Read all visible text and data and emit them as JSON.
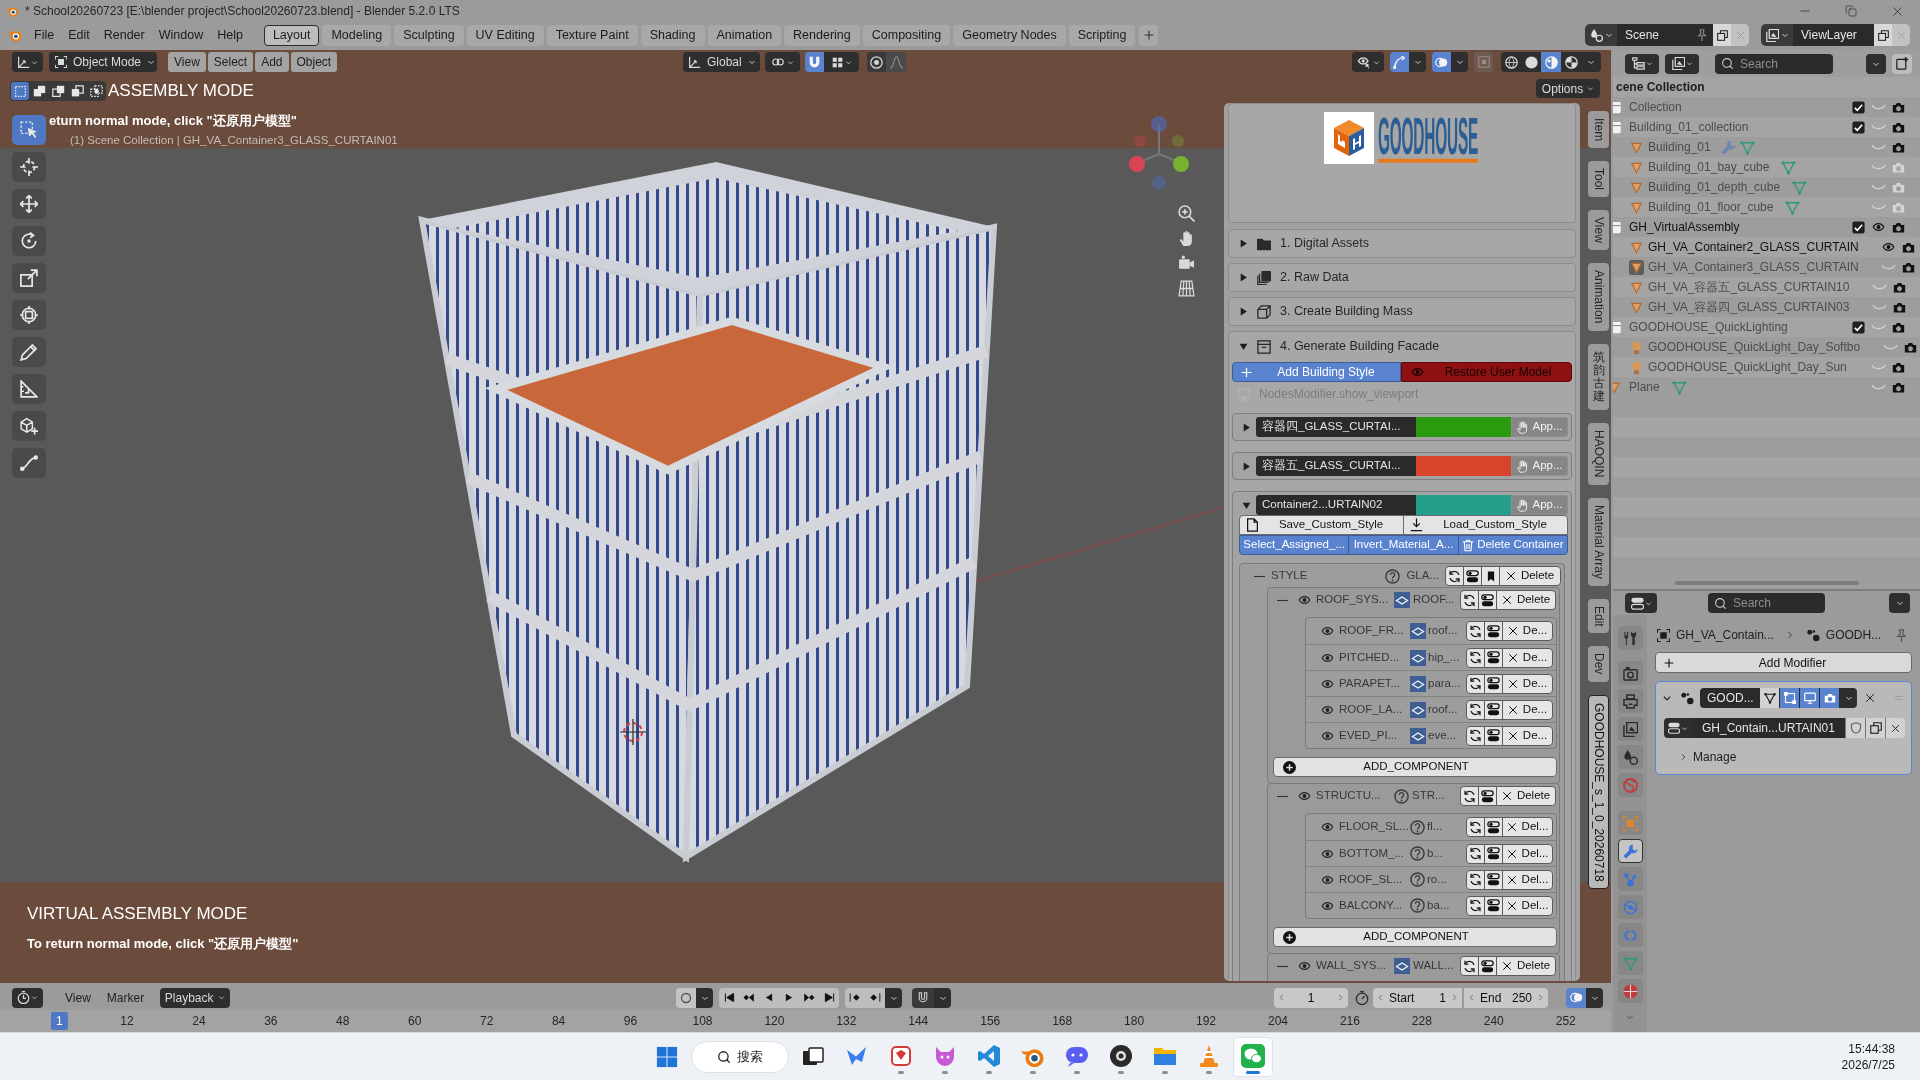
{
  "window": {
    "title": "* School20260723 [E:\\blender project\\School20260723.blend] - Blender 5.2.0 LTS"
  },
  "menu": [
    "File",
    "Edit",
    "Render",
    "Window",
    "Help"
  ],
  "workspaces": [
    {
      "label": "Layout",
      "selected": true
    },
    {
      "label": "Modeling",
      "selected": false
    },
    {
      "label": "Sculpting",
      "selected": false
    },
    {
      "label": "UV Editing",
      "selected": false
    },
    {
      "label": "Texture Paint",
      "selected": false
    },
    {
      "label": "Shading",
      "selected": false
    },
    {
      "label": "Animation",
      "selected": false
    },
    {
      "label": "Rendering",
      "selected": false
    },
    {
      "label": "Compositing",
      "selected": false
    },
    {
      "label": "Geometry Nodes",
      "selected": false
    },
    {
      "label": "Scripting",
      "selected": false
    }
  ],
  "scene": {
    "name": "Scene"
  },
  "view_layer": {
    "name": "ViewLayer"
  },
  "viewport": {
    "mode": "Object Mode",
    "menus": [
      "View",
      "Select",
      "Add",
      "Object"
    ],
    "orientation": "Global",
    "snap": true,
    "proportional": false,
    "gizmos": true,
    "overlays": true,
    "xray": false,
    "shading": [
      {
        "kind": "wireframe",
        "selected": false
      },
      {
        "kind": "solid",
        "selected": false
      },
      {
        "kind": "material",
        "selected": true
      },
      {
        "kind": "rendered",
        "selected": false
      }
    ],
    "options": "Options",
    "select_modes": [
      {
        "kind": "set",
        "selected": true
      },
      {
        "kind": "extend",
        "selected": false
      },
      {
        "kind": "subtract",
        "selected": false
      },
      {
        "kind": "difference",
        "selected": false
      },
      {
        "kind": "intersect",
        "selected": false
      }
    ],
    "title": "ASSEMBLY MODE",
    "hint": "eturn normal mode, click \"还原用户模型\"",
    "context": "(1) Scene Collection | GH_VA_Container3_GLASS_CURTAIN01",
    "tools": [
      {
        "kind": "select_box",
        "selected": true
      },
      {
        "kind": "cursor",
        "selected": false
      },
      {
        "kind": "move",
        "selected": false
      },
      {
        "kind": "rotate",
        "selected": false
      },
      {
        "kind": "scale",
        "selected": false
      },
      {
        "kind": "transform",
        "selected": false
      },
      {
        "kind": "annotate",
        "selected": false
      },
      {
        "kind": "measure",
        "selected": false
      },
      {
        "kind": "add_cube",
        "selected": false
      },
      {
        "kind": "shear",
        "selected": false
      }
    ],
    "footer_title": "VIRTUAL ASSEMBLY MODE",
    "footer_hint": "To return normal mode, click \"还原用户模型\""
  },
  "sidebar": {
    "logo": "GOODHOUSE",
    "sections": [
      {
        "label": "1. Digital Assets",
        "kind": "folder",
        "expanded": false
      },
      {
        "label": "2. Raw Data",
        "kind": "stack",
        "expanded": false
      },
      {
        "label": "3. Create Building Mass",
        "kind": "cube",
        "expanded": false
      },
      {
        "label": "4. Generate Building Facade",
        "kind": "archive",
        "expanded": true,
        "facade": {
          "add_style": "Add Building Style",
          "restore": "Restore User Model",
          "show_viewport": {
            "label": "NodesModifier.show_viewport",
            "disabled": true
          },
          "containers": [
            {
              "name": "容器四_GLASS_CURTAI...",
              "color": "#2a9a0e",
              "apply": {
                "label": "App...",
                "disabled": true
              },
              "expanded": false
            },
            {
              "name": "容器五_GLASS_CURTAI...",
              "color": "#d6452b",
              "apply": {
                "label": "App...",
                "disabled": true
              },
              "expanded": false
            },
            {
              "name": "Container2...URTAIN02",
              "color": "#239f8a",
              "apply": {
                "label": "App...",
                "disabled": true
              },
              "expanded": true,
              "style_actions": [
                {
                  "label": "Save_Custom_Style",
                  "kind": "save"
                },
                {
                  "label": "Load_Custom_Style",
                  "kind": "load"
                }
              ],
              "actions": [
                {
                  "label": "Select_Assigned_...",
                  "kind": "plain"
                },
                {
                  "label": "Invert_Material_A...",
                  "kind": "plain"
                },
                {
                  "label": "Delete Container",
                  "kind": "delete"
                }
              ],
              "style": {
                "label": "STYLE",
                "kind": "help",
                "value": "GLA...",
                "delete": "Delete",
                "expanded": true,
                "systems": [
                  {
                    "name": "ROOF_SYS...",
                    "kind": "thumb",
                    "value": "ROOF...",
                    "delete": "Delete",
                    "expanded": true,
                    "components": [
                      {
                        "name": "ROOF_FR...",
                        "kind": "thumb",
                        "value": "roof...",
                        "delete": "De..."
                      },
                      {
                        "name": "PITCHED...",
                        "kind": "thumb",
                        "value": "hip_...",
                        "delete": "De..."
                      },
                      {
                        "name": "PARAPET...",
                        "kind": "thumb",
                        "value": "para...",
                        "delete": "De..."
                      },
                      {
                        "name": "ROOF_LA...",
                        "kind": "thumb",
                        "value": "roof...",
                        "delete": "De..."
                      },
                      {
                        "name": "EVED_PI...",
                        "kind": "thumb",
                        "value": "eve...",
                        "delete": "De..."
                      }
                    ],
                    "add": "ADD_COMPONENT"
                  },
                  {
                    "name": "STRUCTU...",
                    "kind": "help",
                    "value": "STR...",
                    "delete": "Delete",
                    "expanded": true,
                    "components": [
                      {
                        "name": "FLOOR_SL...",
                        "kind": "help",
                        "value": "fl...",
                        "delete": "Del..."
                      },
                      {
                        "name": "BOTTOM_...",
                        "kind": "help",
                        "value": "b...",
                        "delete": "Del..."
                      },
                      {
                        "name": "ROOF_SL...",
                        "kind": "help",
                        "value": "ro...",
                        "delete": "Del..."
                      },
                      {
                        "name": "BALCONY...",
                        "kind": "help",
                        "value": "ba...",
                        "delete": "Del..."
                      }
                    ],
                    "add": "ADD_COMPONENT"
                  },
                  {
                    "name": "WALL_SYS...",
                    "kind": "thumb",
                    "value": "WALL...",
                    "delete": "Delete",
                    "expanded": true
                  }
                ]
              }
            }
          ]
        }
      }
    ]
  },
  "sidebar_tabs": [
    {
      "label": "Item",
      "kind": "rotated",
      "selected": false
    },
    {
      "label": "Tool",
      "kind": "rotated",
      "selected": false
    },
    {
      "label": "View",
      "kind": "rotated",
      "selected": false
    },
    {
      "label": "Animation",
      "kind": "rotated",
      "selected": false
    },
    {
      "label": "筑韵古建",
      "kind": "stacked",
      "selected": false
    },
    {
      "label": "HAOQIN",
      "kind": "rotated",
      "selected": false
    },
    {
      "label": "Material Array",
      "kind": "rotated",
      "selected": false
    },
    {
      "label": "Edit",
      "kind": "rotated",
      "selected": false
    },
    {
      "label": "Dev",
      "kind": "rotated",
      "selected": false
    },
    {
      "label": "GOODHOUSE_s_1_0_20260718",
      "kind": "rotated",
      "selected": true
    }
  ],
  "outliner": {
    "search": "Search",
    "root": "cene Collection",
    "items": [
      {
        "label": "Collection",
        "kind": "collection",
        "checked": true,
        "visible": false,
        "render": true
      },
      {
        "label": "Building_01_collection",
        "kind": "collection",
        "checked": true,
        "visible": false,
        "render": true,
        "children": [
          {
            "label": "Building_01",
            "kind": "mesh",
            "visible": false,
            "render": true,
            "active": false,
            "modifier": true,
            "mesh_data": true
          },
          {
            "label": "Building_01_bay_cube",
            "kind": "mesh",
            "visible": false,
            "render": false,
            "active": false,
            "mesh_data": true
          },
          {
            "label": "Building_01_depth_cube",
            "kind": "mesh",
            "visible": false,
            "render": false,
            "active": false,
            "mesh_data": true
          },
          {
            "label": "Building_01_floor_cube",
            "kind": "mesh",
            "visible": false,
            "render": false,
            "active": false,
            "mesh_data": true
          }
        ]
      },
      {
        "label": "GH_VirtualAssembly",
        "kind": "collection",
        "checked": true,
        "visible": true,
        "render": true,
        "children": [
          {
            "label": "GH_VA_Container2_GLASS_CURTAIN",
            "kind": "mesh",
            "visible": true,
            "render": true,
            "active": false
          },
          {
            "label": "GH_VA_Container3_GLASS_CURTAIN",
            "kind": "mesh",
            "visible": false,
            "render": true,
            "active": true
          },
          {
            "label": "GH_VA_容器五_GLASS_CURTAIN10",
            "kind": "mesh",
            "visible": false,
            "render": true,
            "active": false
          },
          {
            "label": "GH_VA_容器四_GLASS_CURTAIN03",
            "kind": "mesh",
            "visible": false,
            "render": true,
            "active": false
          }
        ]
      },
      {
        "label": "GOODHOUSE_QuickLighting",
        "kind": "collection",
        "checked": true,
        "visible": false,
        "render": true,
        "children": [
          {
            "label": "GOODHOUSE_QuickLight_Day_Softbo",
            "kind": "light",
            "visible": false,
            "render": true
          },
          {
            "label": "GOODHOUSE_QuickLight_Day_Sun",
            "kind": "light",
            "visible": false,
            "render": true
          }
        ]
      },
      {
        "label": "Plane",
        "kind": "mesh",
        "visible": false,
        "render": true,
        "active": false,
        "mesh_data": true
      }
    ]
  },
  "properties": {
    "search": "Search",
    "tabs": [
      {
        "kind": "tool",
        "selected": false
      },
      {
        "kind": "render",
        "selected": false
      },
      {
        "kind": "output",
        "selected": false
      },
      {
        "kind": "view_layer",
        "selected": false
      },
      {
        "kind": "scene",
        "selected": false
      },
      {
        "kind": "world",
        "selected": false
      },
      {
        "kind": "object",
        "selected": false
      },
      {
        "kind": "modifiers",
        "selected": true
      },
      {
        "kind": "particles",
        "selected": false
      },
      {
        "kind": "physics",
        "selected": false
      },
      {
        "kind": "constraints",
        "selected": false
      },
      {
        "kind": "data",
        "selected": false
      },
      {
        "kind": "material",
        "selected": false
      }
    ],
    "path": [
      "GH_VA_Contain...",
      "GOODH..."
    ],
    "add_modifier": "Add Modifier",
    "modifier": {
      "name": "GOOD...",
      "expanded": true,
      "toggles": [
        {
          "kind": "cage",
          "on": false
        },
        {
          "kind": "edit_mode",
          "on": true
        },
        {
          "kind": "viewport",
          "on": true
        },
        {
          "kind": "render",
          "on": true
        }
      ],
      "group": "GH_Contain...URTAIN01",
      "manage": "Manage"
    }
  },
  "timeline": {
    "menus": [
      "View",
      "Marker"
    ],
    "playback": "Playback",
    "frame": "1",
    "start_label": "Start",
    "start": "1",
    "end_label": "End",
    "end": "250",
    "ruler": [
      {
        "label": "1",
        "selected": true
      },
      {
        "label": "12",
        "selected": false
      },
      {
        "label": "24",
        "selected": false
      },
      {
        "label": "36",
        "selected": false
      },
      {
        "label": "48",
        "selected": false
      },
      {
        "label": "60",
        "selected": false
      },
      {
        "label": "72",
        "selected": false
      },
      {
        "label": "84",
        "selected": false
      },
      {
        "label": "96",
        "selected": false
      },
      {
        "label": "108",
        "selected": false
      },
      {
        "label": "120",
        "selected": false
      },
      {
        "label": "132",
        "selected": false
      },
      {
        "label": "144",
        "selected": false
      },
      {
        "label": "156",
        "selected": false
      },
      {
        "label": "168",
        "selected": false
      },
      {
        "label": "180",
        "selected": false
      },
      {
        "label": "192",
        "selected": false
      },
      {
        "label": "204",
        "selected": false
      },
      {
        "label": "216",
        "selected": false
      },
      {
        "label": "228",
        "selected": false
      },
      {
        "label": "240",
        "selected": false
      },
      {
        "label": "252",
        "selected": false
      }
    ]
  },
  "taskbar": {
    "search": "搜索",
    "time": "15:44:38",
    "date": "2026/7/25",
    "apps": [
      {
        "kind": "task_view",
        "running": false,
        "active": false
      },
      {
        "kind": "bird",
        "running": false,
        "active": false
      },
      {
        "kind": "cards",
        "running": true,
        "active": false
      },
      {
        "kind": "cat",
        "running": true,
        "active": false
      },
      {
        "kind": "ribbon",
        "running": true,
        "active": false
      },
      {
        "kind": "ring",
        "running": true,
        "active": false
      },
      {
        "kind": "chat",
        "running": true,
        "active": false
      },
      {
        "kind": "lens",
        "running": true,
        "active": false
      },
      {
        "kind": "folder",
        "running": true,
        "active": false
      },
      {
        "kind": "cone",
        "running": true,
        "active": false
      },
      {
        "kind": "bubbles",
        "running": true,
        "active": true
      }
    ]
  }
}
